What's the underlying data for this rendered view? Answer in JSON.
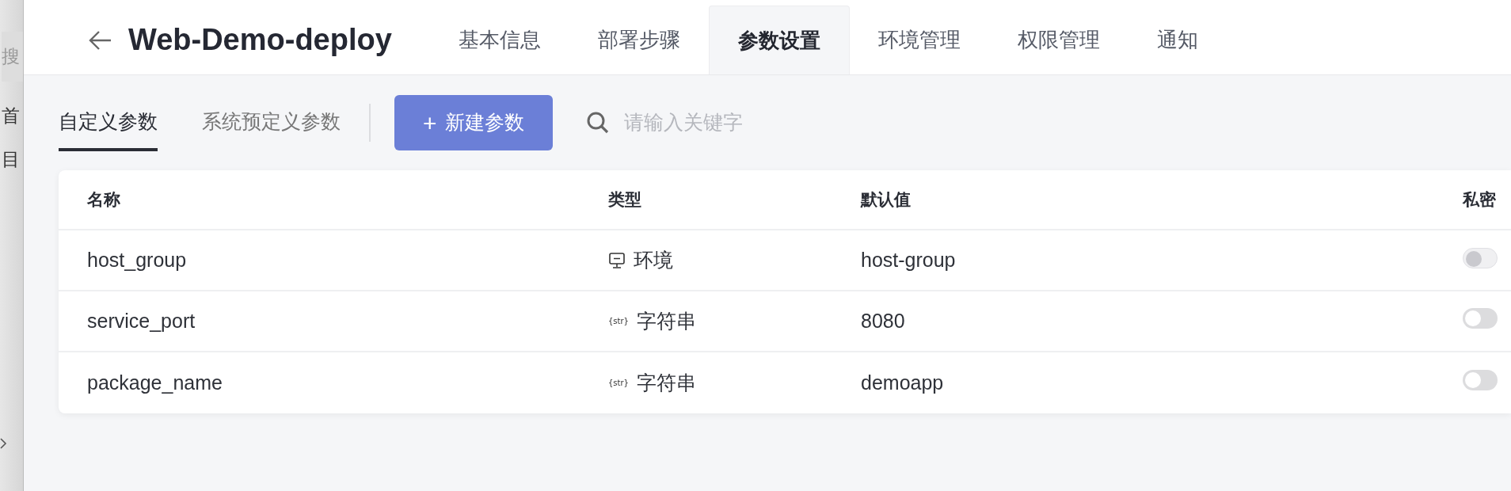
{
  "sidebar": {
    "items": [
      {
        "label": "搜",
        "kind": "search"
      },
      {
        "label": "首",
        "kind": "item"
      },
      {
        "label": "目",
        "kind": "item"
      }
    ]
  },
  "header": {
    "title": "Web-Demo-deploy"
  },
  "tabs": [
    {
      "label": "基本信息",
      "selected": false
    },
    {
      "label": "部署步骤",
      "selected": false
    },
    {
      "label": "参数设置",
      "selected": true
    },
    {
      "label": "环境管理",
      "selected": false
    },
    {
      "label": "权限管理",
      "selected": false
    },
    {
      "label": "通知",
      "selected": false
    }
  ],
  "subtabs": [
    {
      "label": "自定义参数",
      "selected": true
    },
    {
      "label": "系统预定义参数",
      "selected": false
    }
  ],
  "new_button": {
    "icon": "+",
    "label": "新建参数"
  },
  "search": {
    "placeholder": "请输入关键字"
  },
  "table": {
    "columns": [
      "名称",
      "类型",
      "默认值",
      "私密"
    ],
    "rows": [
      {
        "name": "host_group",
        "kind": "environment",
        "type": "环境",
        "default": "host-group",
        "secret": false,
        "disabled": true
      },
      {
        "name": "service_port",
        "kind": "string",
        "type_icon": "{str}",
        "type": "字符串",
        "default": "8080",
        "secret": false,
        "disabled": false
      },
      {
        "name": "package_name",
        "kind": "string",
        "type_icon": "{str}",
        "type": "字符串",
        "default": "demoapp",
        "secret": false,
        "disabled": false
      }
    ]
  }
}
